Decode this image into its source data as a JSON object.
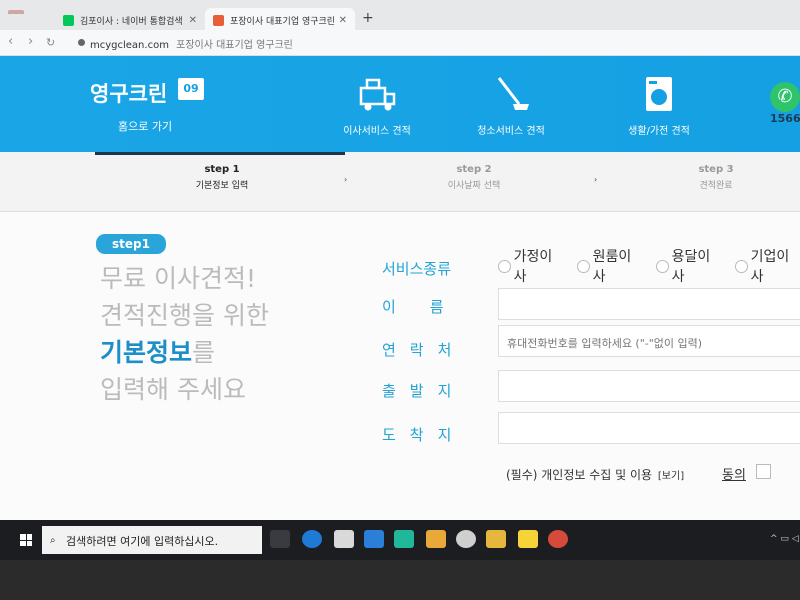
{
  "browser": {
    "tabs": [
      {
        "label": "김포이사 : 네이버 통합검색",
        "close": "✕",
        "favicon_color": "#03c75a"
      },
      {
        "label": "포장이사 대표기업 영구크린",
        "close": "✕",
        "favicon_color": "#e85d3a"
      }
    ],
    "new_tab": "+",
    "back": "‹",
    "forward": "›",
    "reload": "↻",
    "url": "mcygclean.com",
    "page_title": "포장이사 대표기업 영구크린"
  },
  "site": {
    "logo": "영구크린",
    "logo_badge": "09",
    "home_link": "홈으로 가기",
    "nav": [
      {
        "label": "이사서비스 견적",
        "icon": "truck-icon"
      },
      {
        "label": "청소서비스 견적",
        "icon": "mop-icon"
      },
      {
        "label": "생활/가전 견적",
        "icon": "washing-machine-icon"
      }
    ],
    "phone": "1566-"
  },
  "steps": [
    {
      "num": "step 1",
      "label": "기본정보 입력",
      "active": true
    },
    {
      "num": "step 2",
      "label": "이사날짜 선택",
      "active": false
    },
    {
      "num": "step 3",
      "label": "견적완료",
      "active": false
    }
  ],
  "step_arrow": "›",
  "form": {
    "badge": "step1",
    "intro_lines": [
      "무료 이사견적!",
      "견적진행을 위한"
    ],
    "intro_highlight": "기본정보",
    "intro_suffix": "를",
    "intro_last": "입력해 주세요",
    "labels": {
      "service": "서비스종류",
      "name": "이름",
      "contact": "연락처",
      "origin": "출발지",
      "destination": "도착지"
    },
    "service_options": [
      "가정이사",
      "원룸이사",
      "용달이사",
      "기업이사"
    ],
    "contact_placeholder": "휴대전화번호를 입력하세요 (\"-\"없이 입력)",
    "consent": "(필수) 개인정보 수집 및 이용",
    "consent_view": "[보기]",
    "agree": "동의"
  },
  "taskbar": {
    "search_placeholder": "검색하려면 여기에 입력하십시오.",
    "search_icon": "⌕",
    "tray": "^ ▭ ◁"
  },
  "colors": {
    "header": "#1aa6e6",
    "label": "#22a3d6",
    "highlight": "#1c8fc9",
    "step_active": "#1e3550"
  }
}
